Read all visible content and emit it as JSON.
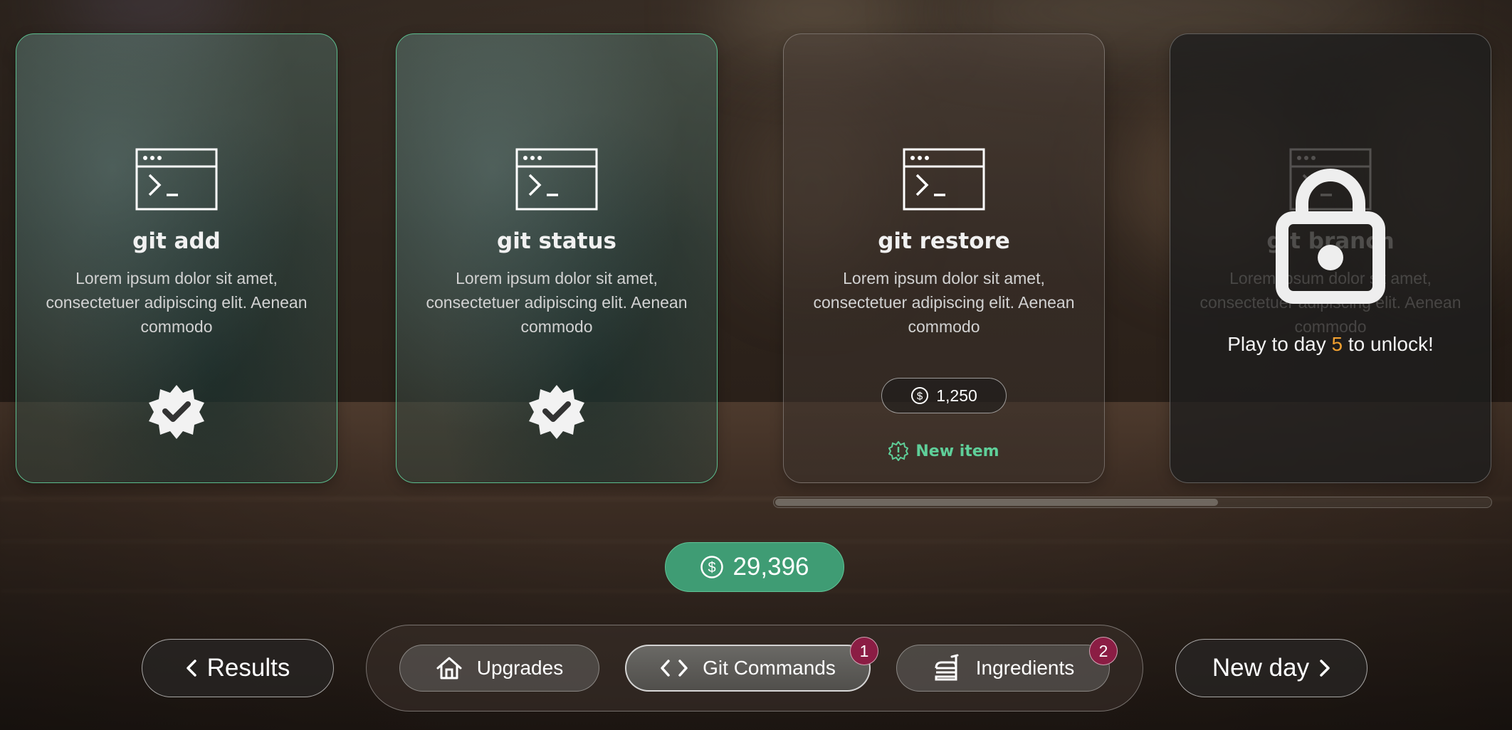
{
  "cards": [
    {
      "title": "git add",
      "description": "Lorem ipsum dolor sit amet, consectetuer adipiscing elit. Aenean commodo",
      "state": "owned",
      "icon": "terminal-icon",
      "status_icon": "verified-check-icon"
    },
    {
      "title": "git status",
      "description": "Lorem ipsum dolor sit amet, consectetuer adipiscing elit. Aenean commodo",
      "state": "owned",
      "icon": "terminal-icon",
      "status_icon": "verified-check-icon"
    },
    {
      "title": "git restore",
      "description": "Lorem ipsum dolor sit amet, consectetuer adipiscing elit. Aenean commodo",
      "state": "for-sale",
      "icon": "terminal-icon",
      "price": "1,250",
      "tag": "New item"
    },
    {
      "title": "git branch",
      "description": "Lorem ipsum dolor sit amet, consectetuer adipiscing elit. Aenean commodo",
      "state": "locked",
      "icon": "terminal-icon",
      "unlock_prefix": "Play to day",
      "unlock_day": "5",
      "unlock_suffix": "to unlock!"
    }
  ],
  "scroll_progress": 0.62,
  "balance": "29,396",
  "nav": {
    "back_label": "Results",
    "next_label": "New day",
    "tabs": [
      {
        "label": "Upgrades",
        "icon": "home-icon",
        "active": false,
        "badge": ""
      },
      {
        "label": "Git Commands",
        "icon": "code-icon",
        "active": true,
        "badge": "1"
      },
      {
        "label": "Ingredients",
        "icon": "food-icon",
        "active": false,
        "badge": "2"
      }
    ]
  },
  "colors": {
    "owned_border": "#5bbd8e",
    "balance_bg": "#3f9c74",
    "new_item": "#5fcf99",
    "unlock_day": "#f0a030",
    "badge": "#8b1d44"
  }
}
